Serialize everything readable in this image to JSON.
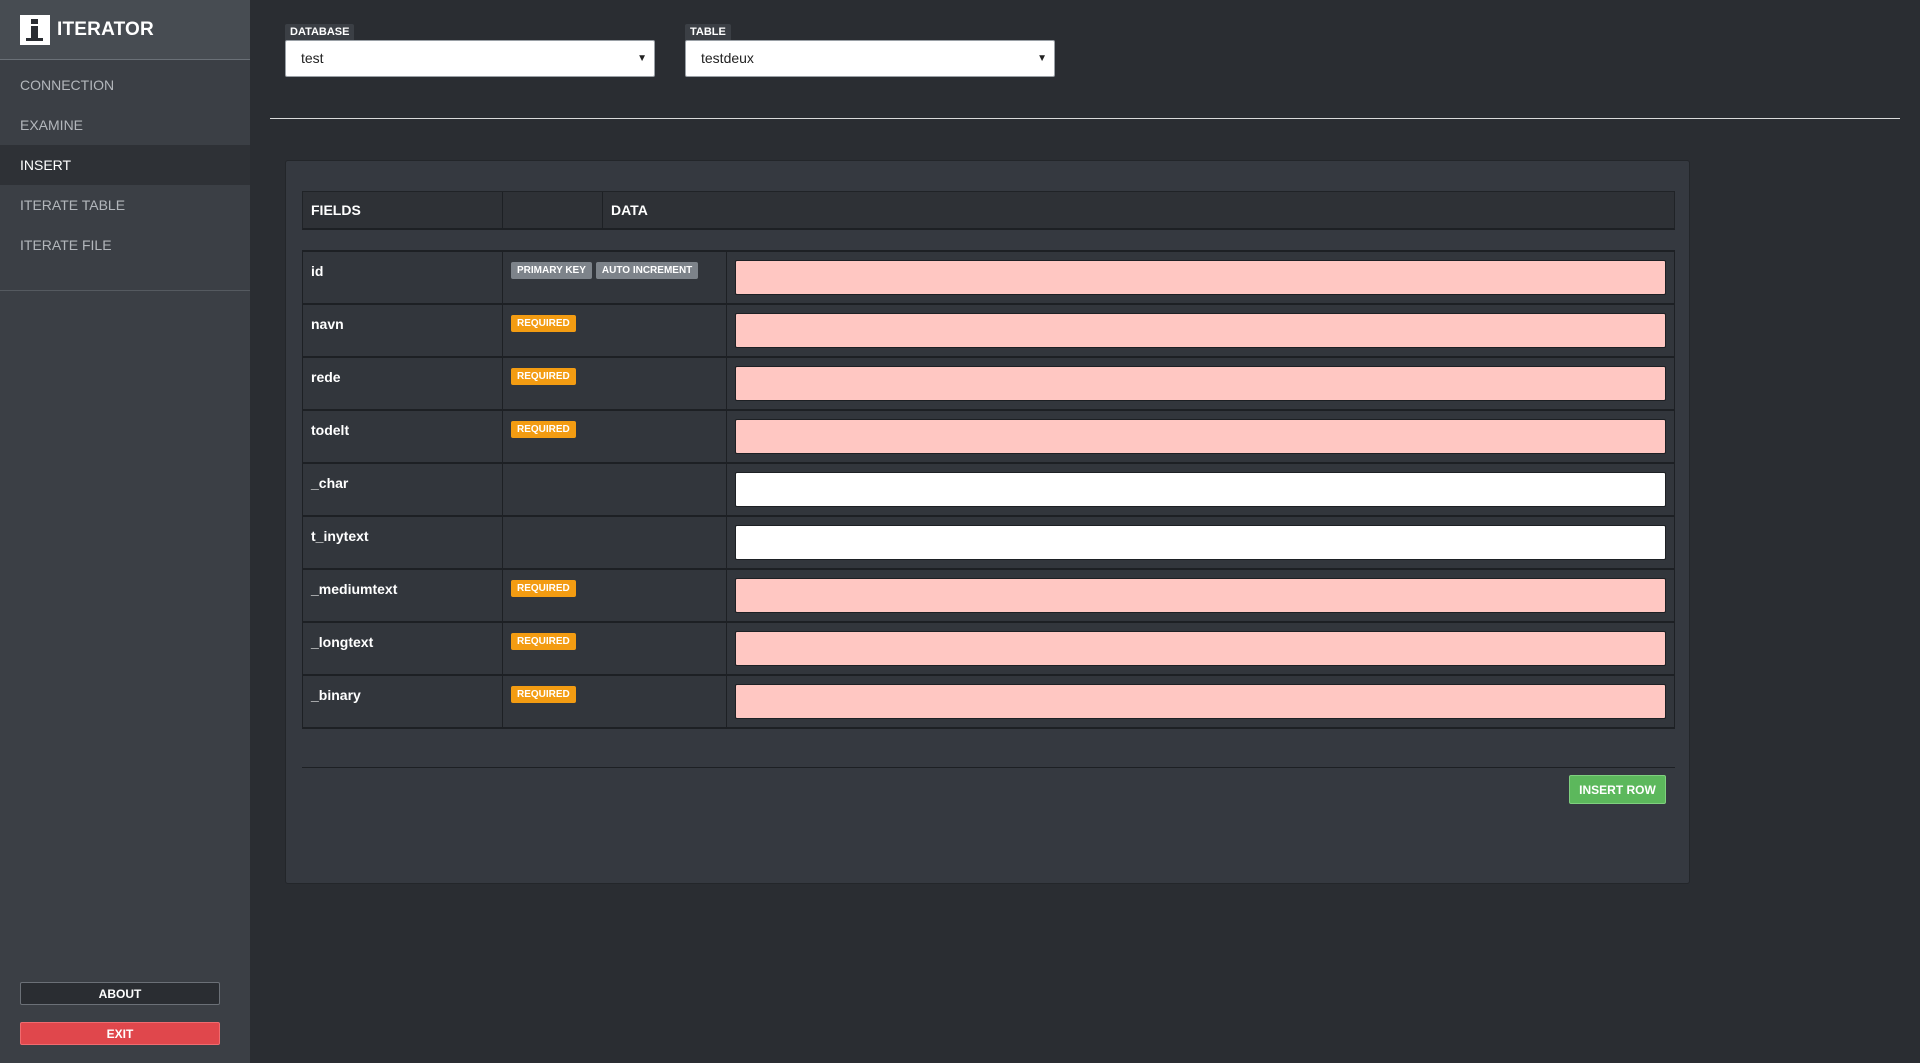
{
  "app": {
    "title": "ITERATOR"
  },
  "sidebar": {
    "items": [
      {
        "label": "CONNECTION",
        "active": false
      },
      {
        "label": "EXAMINE",
        "active": false
      },
      {
        "label": "INSERT",
        "active": true
      },
      {
        "label": "ITERATE TABLE",
        "active": false
      },
      {
        "label": "ITERATE FILE",
        "active": false
      }
    ],
    "about_label": "ABOUT",
    "exit_label": "EXIT"
  },
  "selectors": {
    "database": {
      "label": "DATABASE",
      "value": "test"
    },
    "table": {
      "label": "TABLE",
      "value": "testdeux"
    }
  },
  "table": {
    "headers": [
      "FIELDS",
      "",
      "DATA"
    ],
    "rows": [
      {
        "name": "id",
        "tags": [
          "PRIMARY KEY",
          "AUTO INCREMENT"
        ],
        "value": "",
        "required": true
      },
      {
        "name": "navn",
        "tags": [
          "REQUIRED"
        ],
        "value": "",
        "required": true
      },
      {
        "name": "rede",
        "tags": [
          "REQUIRED"
        ],
        "value": "",
        "required": true
      },
      {
        "name": "todelt",
        "tags": [
          "REQUIRED"
        ],
        "value": "",
        "required": true
      },
      {
        "name": "_char",
        "tags": [],
        "value": "",
        "required": false
      },
      {
        "name": "t_inytext",
        "tags": [],
        "value": "",
        "required": false
      },
      {
        "name": "_mediumtext",
        "tags": [
          "REQUIRED"
        ],
        "value": "",
        "required": true
      },
      {
        "name": "_longtext",
        "tags": [
          "REQUIRED"
        ],
        "value": "",
        "required": true
      },
      {
        "name": "_binary",
        "tags": [
          "REQUIRED"
        ],
        "value": "",
        "required": true
      }
    ]
  },
  "actions": {
    "insert_label": "INSERT ROW"
  },
  "colors": {
    "background": "#2a2d32",
    "sidebar": "#3b3f45",
    "required_tag": "#f39c12",
    "key_tag": "#7d838a",
    "invalid_input": "#ffc7c2",
    "insert_button": "#5cb85c",
    "exit_button": "#e0474c"
  }
}
